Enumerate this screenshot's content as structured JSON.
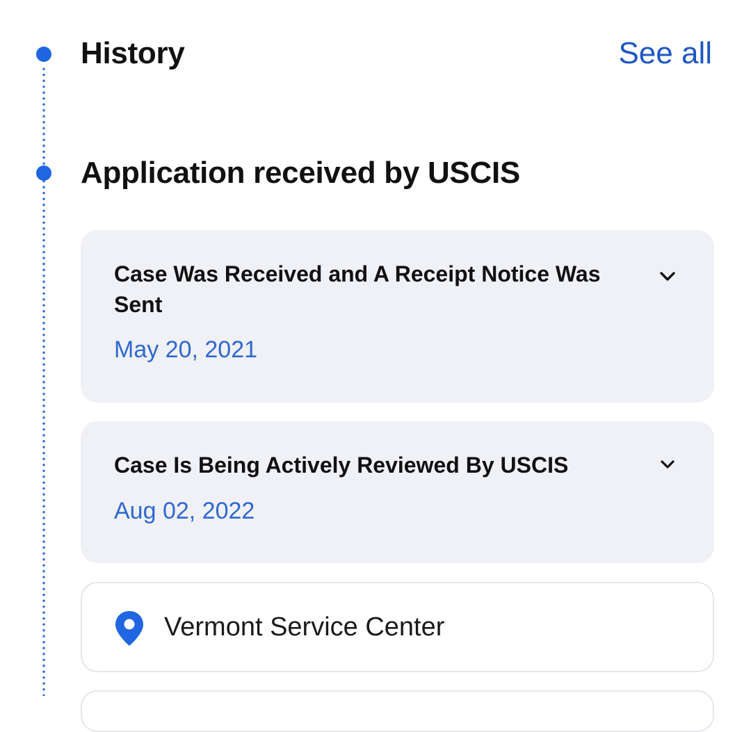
{
  "header": {
    "title": "History",
    "see_all_label": "See all"
  },
  "section": {
    "title": "Application received by USCIS"
  },
  "events": [
    {
      "title": "Case Was Received and A Receipt Notice Was Sent",
      "date": "May 20, 2021",
      "icon": "chevron-down-icon"
    },
    {
      "title": "Case Is Being Actively Reviewed By USCIS",
      "date": "Aug 02, 2022",
      "icon": "chevron-down-icon"
    }
  ],
  "location": {
    "icon": "location-pin-icon",
    "label": "Vermont Service Center"
  },
  "colors": {
    "accent": "#1f66e0",
    "link": "#1f57c3",
    "date": "#2f68cf",
    "card_bg": "#f0f1f6"
  }
}
